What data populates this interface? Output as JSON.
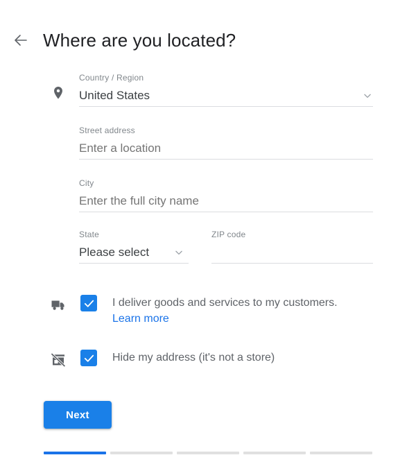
{
  "header": {
    "back_icon": "arrow-left-icon",
    "title": "Where are you located?"
  },
  "form": {
    "country": {
      "icon": "location-pin-icon",
      "label": "Country / Region",
      "value": "United States",
      "chevron": "chevron-down-icon"
    },
    "street": {
      "label": "Street address",
      "placeholder": "Enter a location",
      "value": ""
    },
    "city": {
      "label": "City",
      "placeholder": "Enter the full city name",
      "value": ""
    },
    "state": {
      "label": "State",
      "value": "Please select",
      "chevron": "chevron-down-icon"
    },
    "zip": {
      "label": "ZIP code",
      "placeholder": "",
      "value": ""
    }
  },
  "options": [
    {
      "icon": "delivery-truck-icon",
      "checked": true,
      "label": "I deliver goods and services to my customers.",
      "link": "Learn more"
    },
    {
      "icon": "store-off-icon",
      "checked": true,
      "label": "Hide my address (it's not a store)",
      "link": ""
    }
  ],
  "actions": {
    "next_label": "Next"
  },
  "progress": {
    "total_steps": 5,
    "current_step": 1
  },
  "colors": {
    "accent_blue": "#1a80e8",
    "link_blue": "#1a73e8",
    "icon_gray": "#5f6368",
    "label_gray": "#80868b",
    "text_gray": "#5f6368",
    "title_dark": "#202124",
    "underline": "#dadce0",
    "progress_inactive": "#e0e0e0"
  }
}
